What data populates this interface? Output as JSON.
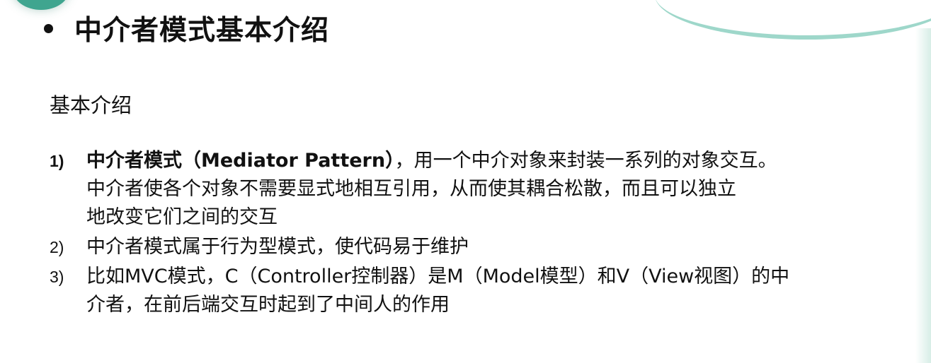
{
  "title": "中介者模式基本介绍",
  "subtitle": "基本介绍",
  "items": [
    {
      "number": "1)",
      "lead_bold": "中介者模式（Mediator Pattern）",
      "lead_rest": "，用一个中介对象来封装一系列的对象交互。",
      "line2": "中介者使各个对象不需要显式地相互引用，从而使其耦合松散，而且可以独立",
      "line3": "地改变它们之间的交互"
    },
    {
      "number": "2)",
      "line1": "中介者模式属于行为型模式，使代码易于维护"
    },
    {
      "number": "3)",
      "line1": "比如MVC模式，C（Controller控制器）是M（Model模型）和V（View视图）的中",
      "line2": "介者，在前后端交互时起到了中间人的作用"
    }
  ]
}
